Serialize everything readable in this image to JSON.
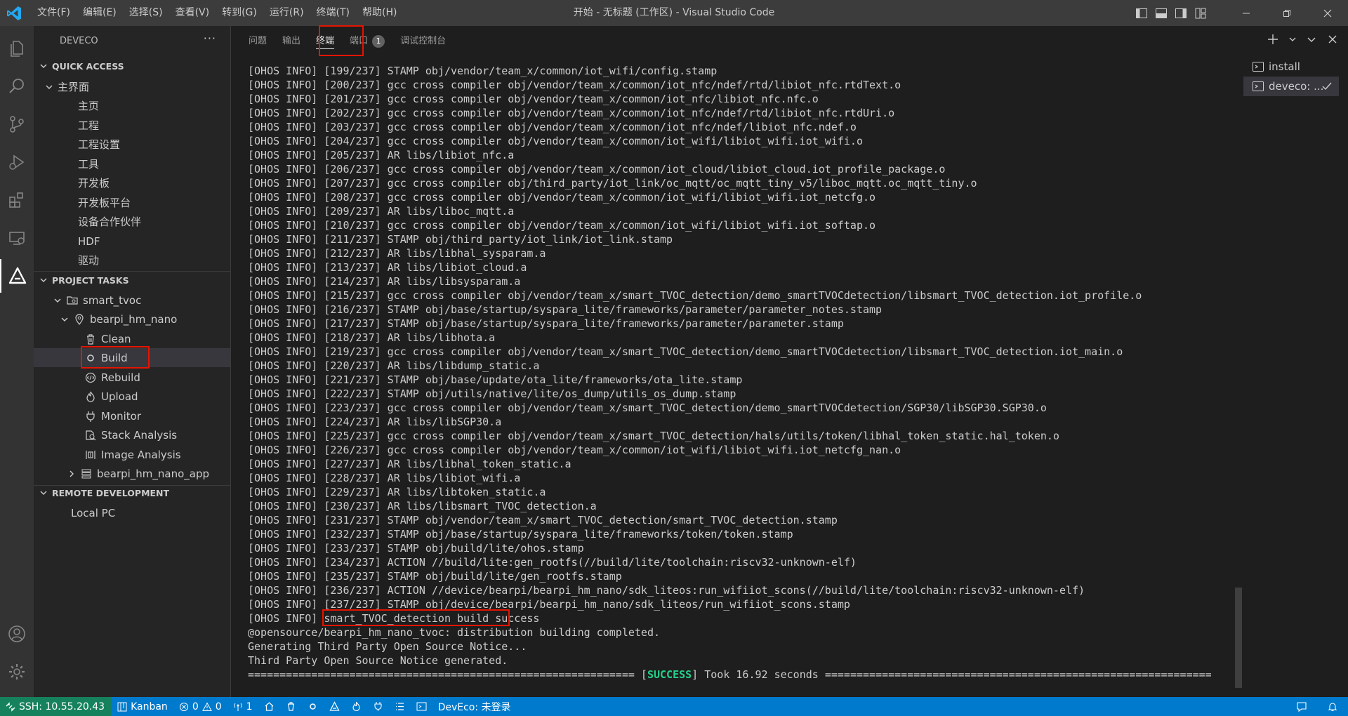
{
  "window": {
    "title": "开始 - 无标题 (工作区) - Visual Studio Code",
    "menus": [
      "文件(F)",
      "编辑(E)",
      "选择(S)",
      "查看(V)",
      "转到(G)",
      "运行(R)",
      "终端(T)",
      "帮助(H)"
    ]
  },
  "sidebar": {
    "title": "DEVECO",
    "more": "···",
    "quick_access": {
      "header": "QUICK ACCESS",
      "group": "主界面",
      "items": [
        "主页",
        "工程",
        "工程设置",
        "工具",
        "开发板",
        "开发板平台",
        "设备合作伙伴",
        "HDF",
        "驱动"
      ]
    },
    "project_tasks": {
      "header": "PROJECT TASKS",
      "project": "smart_tvoc",
      "board": "bearpi_hm_nano",
      "tasks": [
        "Clean",
        "Build",
        "Rebuild",
        "Upload",
        "Monitor",
        "Stack Analysis",
        "Image Analysis"
      ],
      "app": "bearpi_hm_nano_app"
    },
    "remote": {
      "header": "REMOTE DEVELOPMENT",
      "item": "Local PC"
    }
  },
  "panel": {
    "tabs": [
      "问题",
      "输出",
      "终端",
      "端口",
      "调试控制台"
    ],
    "active_tab": "终端",
    "ports_badge": "1",
    "terminal_list": [
      "install",
      "deveco: ..."
    ],
    "terminal_lines": [
      "[OHOS INFO] [199/237] STAMP obj/vendor/team_x/common/iot_wifi/config.stamp",
      "[OHOS INFO] [200/237] gcc cross compiler obj/vendor/team_x/common/iot_nfc/ndef/rtd/libiot_nfc.rtdText.o",
      "[OHOS INFO] [201/237] gcc cross compiler obj/vendor/team_x/common/iot_nfc/libiot_nfc.nfc.o",
      "[OHOS INFO] [202/237] gcc cross compiler obj/vendor/team_x/common/iot_nfc/ndef/rtd/libiot_nfc.rtdUri.o",
      "[OHOS INFO] [203/237] gcc cross compiler obj/vendor/team_x/common/iot_nfc/ndef/libiot_nfc.ndef.o",
      "[OHOS INFO] [204/237] gcc cross compiler obj/vendor/team_x/common/iot_wifi/libiot_wifi.iot_wifi.o",
      "[OHOS INFO] [205/237] AR libs/libiot_nfc.a",
      "[OHOS INFO] [206/237] gcc cross compiler obj/vendor/team_x/common/iot_cloud/libiot_cloud.iot_profile_package.o",
      "[OHOS INFO] [207/237] gcc cross compiler obj/third_party/iot_link/oc_mqtt/oc_mqtt_tiny_v5/liboc_mqtt.oc_mqtt_tiny.o",
      "[OHOS INFO] [208/237] gcc cross compiler obj/vendor/team_x/common/iot_wifi/libiot_wifi.iot_netcfg.o",
      "[OHOS INFO] [209/237] AR libs/liboc_mqtt.a",
      "[OHOS INFO] [210/237] gcc cross compiler obj/vendor/team_x/common/iot_wifi/libiot_wifi.iot_softap.o",
      "[OHOS INFO] [211/237] STAMP obj/third_party/iot_link/iot_link.stamp",
      "[OHOS INFO] [212/237] AR libs/libhal_sysparam.a",
      "[OHOS INFO] [213/237] AR libs/libiot_cloud.a",
      "[OHOS INFO] [214/237] AR libs/libsysparam.a",
      "[OHOS INFO] [215/237] gcc cross compiler obj/vendor/team_x/smart_TVOC_detection/demo_smartTVOCdetection/libsmart_TVOC_detection.iot_profile.o",
      "[OHOS INFO] [216/237] STAMP obj/base/startup/syspara_lite/frameworks/parameter/parameter_notes.stamp",
      "[OHOS INFO] [217/237] STAMP obj/base/startup/syspara_lite/frameworks/parameter/parameter.stamp",
      "[OHOS INFO] [218/237] AR libs/libhota.a",
      "[OHOS INFO] [219/237] gcc cross compiler obj/vendor/team_x/smart_TVOC_detection/demo_smartTVOCdetection/libsmart_TVOC_detection.iot_main.o",
      "[OHOS INFO] [220/237] AR libs/libdump_static.a",
      "[OHOS INFO] [221/237] STAMP obj/base/update/ota_lite/frameworks/ota_lite.stamp",
      "[OHOS INFO] [222/237] STAMP obj/utils/native/lite/os_dump/utils_os_dump.stamp",
      "[OHOS INFO] [223/237] gcc cross compiler obj/vendor/team_x/smart_TVOC_detection/demo_smartTVOCdetection/SGP30/libSGP30.SGP30.o",
      "[OHOS INFO] [224/237] AR libs/libSGP30.a",
      "[OHOS INFO] [225/237] gcc cross compiler obj/vendor/team_x/smart_TVOC_detection/hals/utils/token/libhal_token_static.hal_token.o",
      "[OHOS INFO] [226/237] gcc cross compiler obj/vendor/team_x/common/iot_wifi/libiot_wifi.iot_netcfg_nan.o",
      "[OHOS INFO] [227/237] AR libs/libhal_token_static.a",
      "[OHOS INFO] [228/237] AR libs/libiot_wifi.a",
      "[OHOS INFO] [229/237] AR libs/libtoken_static.a",
      "[OHOS INFO] [230/237] AR libs/libsmart_TVOC_detection.a",
      "[OHOS INFO] [231/237] STAMP obj/vendor/team_x/smart_TVOC_detection/smart_TVOC_detection.stamp",
      "[OHOS INFO] [232/237] STAMP obj/base/startup/syspara_lite/frameworks/token/token.stamp",
      "[OHOS INFO] [233/237] STAMP obj/build/lite/ohos.stamp",
      "[OHOS INFO] [234/237] ACTION //build/lite:gen_rootfs(//build/lite/toolchain:riscv32-unknown-elf)",
      "[OHOS INFO] [235/237] STAMP obj/build/lite/gen_rootfs.stamp",
      "[OHOS INFO] [236/237] ACTION //device/bearpi/bearpi_hm_nano/sdk_liteos:run_wifiiot_scons(//build/lite/toolchain:riscv32-unknown-elf)",
      "[OHOS INFO] [237/237] STAMP obj/device/bearpi/bearpi_hm_nano/sdk_liteos/run_wifiiot_scons.stamp"
    ],
    "success_prefix": "[OHOS INFO] ",
    "success_message": "smart_TVOC_detection build success",
    "after_lines": [
      "@opensource/bearpi_hm_nano_tvoc: distribution building completed.",
      "Generating Third Party Open Source Notice...",
      "Third Party Open Source Notice generated."
    ],
    "final_left": "============================================================= [",
    "final_status": "SUCCESS",
    "final_right": "] Took 16.92 seconds ============================================================="
  },
  "statusbar": {
    "remote": "SSH: 10.55.20.43",
    "kanban": "Kanban",
    "errors": "0",
    "warnings": "0",
    "ports": "1",
    "deveco": "DevEco: 未登录"
  },
  "colors": {
    "accent": "#007acc",
    "remote": "#16825d",
    "highlight_box": "#e51400",
    "success_green": "#23d18b"
  }
}
